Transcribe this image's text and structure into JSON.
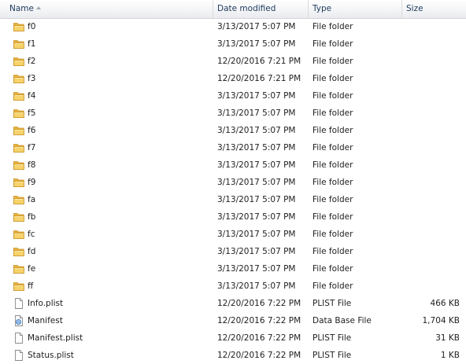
{
  "columns": {
    "name": "Name",
    "date": "Date modified",
    "type": "Type",
    "size": "Size"
  },
  "rows": [
    {
      "name": "f0",
      "date": "3/13/2017 5:07 PM",
      "type": "File folder",
      "size": "",
      "icon": "folder-icon"
    },
    {
      "name": "f1",
      "date": "3/13/2017 5:07 PM",
      "type": "File folder",
      "size": "",
      "icon": "folder-icon"
    },
    {
      "name": "f2",
      "date": "12/20/2016 7:21 PM",
      "type": "File folder",
      "size": "",
      "icon": "folder-icon"
    },
    {
      "name": "f3",
      "date": "12/20/2016 7:21 PM",
      "type": "File folder",
      "size": "",
      "icon": "folder-icon"
    },
    {
      "name": "f4",
      "date": "3/13/2017 5:07 PM",
      "type": "File folder",
      "size": "",
      "icon": "folder-icon"
    },
    {
      "name": "f5",
      "date": "3/13/2017 5:07 PM",
      "type": "File folder",
      "size": "",
      "icon": "folder-icon"
    },
    {
      "name": "f6",
      "date": "3/13/2017 5:07 PM",
      "type": "File folder",
      "size": "",
      "icon": "folder-icon"
    },
    {
      "name": "f7",
      "date": "3/13/2017 5:07 PM",
      "type": "File folder",
      "size": "",
      "icon": "folder-icon"
    },
    {
      "name": "f8",
      "date": "3/13/2017 5:07 PM",
      "type": "File folder",
      "size": "",
      "icon": "folder-icon"
    },
    {
      "name": "f9",
      "date": "3/13/2017 5:07 PM",
      "type": "File folder",
      "size": "",
      "icon": "folder-icon"
    },
    {
      "name": "fa",
      "date": "3/13/2017 5:07 PM",
      "type": "File folder",
      "size": "",
      "icon": "folder-icon"
    },
    {
      "name": "fb",
      "date": "3/13/2017 5:07 PM",
      "type": "File folder",
      "size": "",
      "icon": "folder-icon"
    },
    {
      "name": "fc",
      "date": "3/13/2017 5:07 PM",
      "type": "File folder",
      "size": "",
      "icon": "folder-icon"
    },
    {
      "name": "fd",
      "date": "3/13/2017 5:07 PM",
      "type": "File folder",
      "size": "",
      "icon": "folder-icon"
    },
    {
      "name": "fe",
      "date": "3/13/2017 5:07 PM",
      "type": "File folder",
      "size": "",
      "icon": "folder-icon"
    },
    {
      "name": "ff",
      "date": "3/13/2017 5:07 PM",
      "type": "File folder",
      "size": "",
      "icon": "folder-icon"
    },
    {
      "name": "Info.plist",
      "date": "12/20/2016 7:22 PM",
      "type": "PLIST File",
      "size": "466 KB",
      "icon": "file-icon"
    },
    {
      "name": "Manifest",
      "date": "12/20/2016 7:22 PM",
      "type": "Data Base File",
      "size": "1,704 KB",
      "icon": "database-file-icon"
    },
    {
      "name": "Manifest.plist",
      "date": "12/20/2016 7:22 PM",
      "type": "PLIST File",
      "size": "31 KB",
      "icon": "file-icon"
    },
    {
      "name": "Status.plist",
      "date": "12/20/2016 7:22 PM",
      "type": "PLIST File",
      "size": "1 KB",
      "icon": "file-icon"
    }
  ],
  "colors": {
    "header_text": "#1e395b",
    "text": "#1e1e1e",
    "folder": "#f2c94c"
  }
}
